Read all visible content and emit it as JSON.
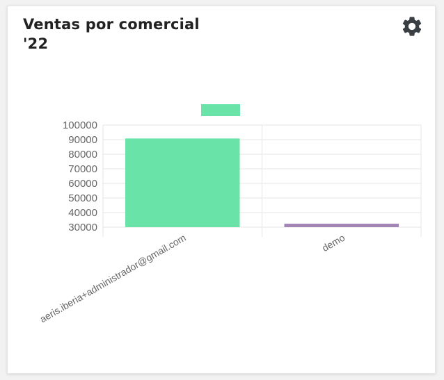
{
  "widget": {
    "title_line1": "Ventas por comercial",
    "title_line2": "'22",
    "settings_icon": "gear-icon"
  },
  "colors": {
    "bar_1": "#6ae3a8",
    "bar_2": "#a486b6",
    "legend_swatch": "#6ae3a8",
    "grid": "#e4e4e4",
    "axis_text": "#666666",
    "icon": "#3a3f44"
  },
  "chart_data": {
    "type": "bar",
    "title": "Ventas por comercial '22",
    "categories": [
      "aeris.iberia+administrador@gmail.com",
      "demo"
    ],
    "values": [
      90800,
      32400
    ],
    "ylim": [
      30000,
      100000
    ],
    "yticks": [
      100000,
      90000,
      80000,
      70000,
      60000,
      50000,
      40000,
      30000
    ],
    "xlabel": "",
    "ylabel": "",
    "grid": true,
    "legend": "top"
  }
}
